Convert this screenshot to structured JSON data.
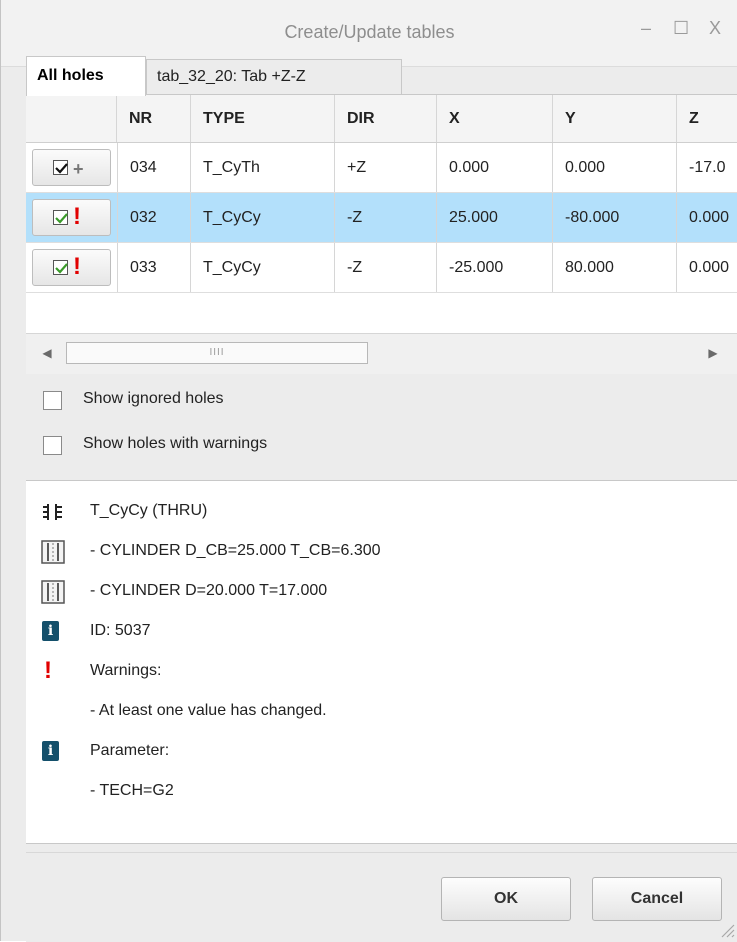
{
  "window": {
    "title": "Create/Update tables",
    "minimize_glyph": "–",
    "maximize_glyph": "☐",
    "close_glyph": "X"
  },
  "tabs": [
    {
      "label": "All holes"
    },
    {
      "label": "tab_32_20: Tab +Z-Z"
    }
  ],
  "table": {
    "columns": [
      "NR",
      "TYPE",
      "DIR",
      "X",
      "Y",
      "Z"
    ],
    "rows": [
      {
        "nr": "034",
        "type": "T_CyTh",
        "dir": "+Z",
        "x": "0.000",
        "y": "0.000",
        "z": "-17.0",
        "status": "plus",
        "checked": true
      },
      {
        "nr": "032",
        "type": "T_CyCy",
        "dir": "-Z",
        "x": "25.000",
        "y": "-80.000",
        "z": "0.000",
        "status": "warning",
        "checked": true
      },
      {
        "nr": "033",
        "type": "T_CyCy",
        "dir": "-Z",
        "x": "-25.000",
        "y": "80.000",
        "z": "0.000",
        "status": "warning",
        "checked": true
      }
    ],
    "scrollbar_grip": "IIII"
  },
  "options": {
    "show_ignored": "Show ignored holes",
    "show_warnings": "Show holes with warnings"
  },
  "details": {
    "type_line": "T_CyCy (THRU)",
    "cyl1": "- CYLINDER  D_CB=25.000 T_CB=6.300",
    "cyl2": "- CYLINDER  D=20.000 T=17.000",
    "id": "ID: 5037",
    "warnings_label": "Warnings:",
    "warning_text": "- At least one value has changed.",
    "parameter_label": "Parameter:",
    "parameter_value": "- TECH=G2"
  },
  "buttons": {
    "ok": "OK",
    "cancel": "Cancel"
  },
  "colors": {
    "selected_row": "#b3e0fb",
    "warning": "#e10000",
    "info_icon": "#14506b"
  }
}
